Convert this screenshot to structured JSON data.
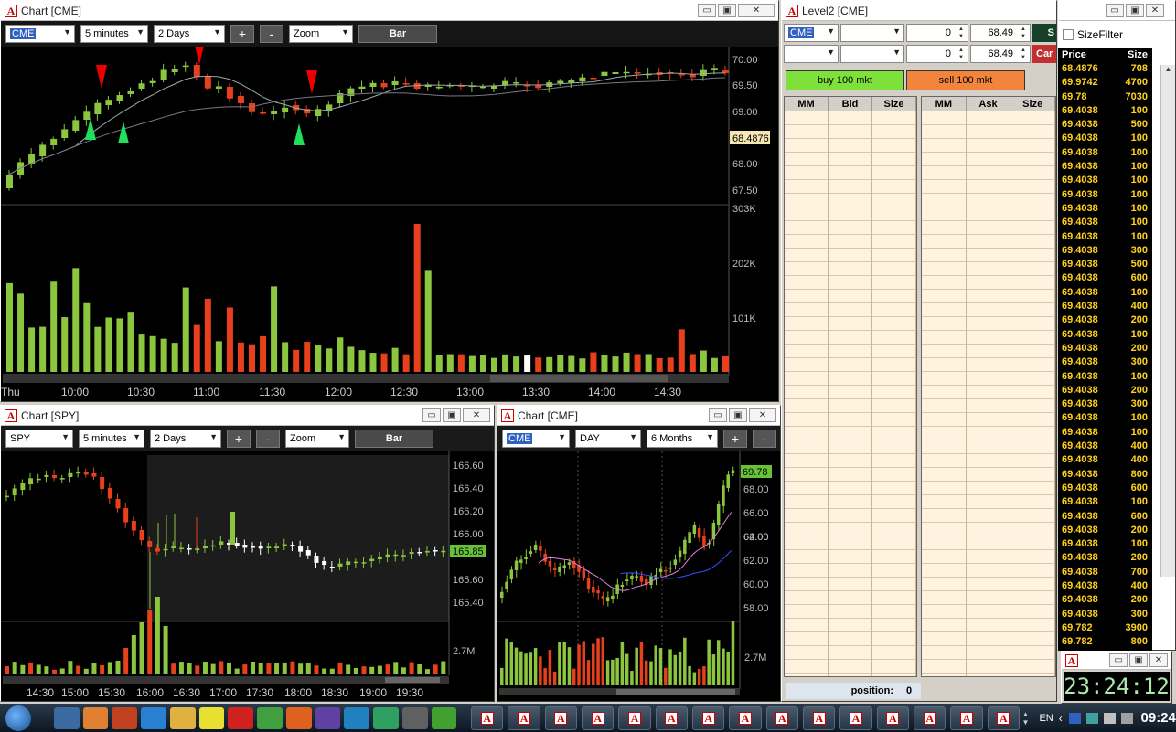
{
  "main_chart": {
    "title": "Chart [CME]",
    "symbol": "CME",
    "interval": "5 minutes",
    "range": "2 Days",
    "zoom": "Zoom",
    "mode": "Bar",
    "plus": "+",
    "minus": "-",
    "price_ticks": [
      "70.00",
      "69.50",
      "69.00",
      "68.00",
      "67.50"
    ],
    "last_price": "68.4876",
    "volume_ticks": [
      "303K",
      "202K",
      "101K"
    ],
    "time_labels": [
      "Thu",
      "10:00",
      "10:30",
      "11:00",
      "11:30",
      "12:00",
      "12:30",
      "13:00",
      "13:30",
      "14:00",
      "14:30"
    ]
  },
  "spy_chart": {
    "title": "Chart [SPY]",
    "symbol": "SPY",
    "interval": "5 minutes",
    "range": "2 Days",
    "zoom": "Zoom",
    "mode": "Bar",
    "plus": "+",
    "minus": "-",
    "price_ticks": [
      "166.60",
      "166.40",
      "166.20",
      "166.00",
      "165.60",
      "165.40"
    ],
    "last_price": "165.85",
    "volume_tick": "2.7M",
    "time_labels": [
      "14:30",
      "15:00",
      "15:30",
      "16:00",
      "16:30",
      "17:00",
      "17:30",
      "18:00",
      "18:30",
      "19:00",
      "19:30"
    ]
  },
  "day_chart": {
    "title": "Chart [CME]",
    "symbol": "CME",
    "interval": "DAY",
    "range": "6 Months",
    "plus": "+",
    "minus": "-",
    "price_ticks": [
      "68.00",
      "66.00",
      "64.00",
      "62.00",
      "62.00",
      "60.00",
      "58.00"
    ],
    "last_price": "69.78",
    "volume_tick": "2.7M"
  },
  "level2": {
    "title": "Level2 [CME]",
    "symbol": "CME",
    "qty1": "0",
    "price1": "68.49",
    "qty2": "0",
    "price2": "68.49",
    "side_btn1": "S",
    "side_btn2": "Car",
    "buy_label": "buy 100 mkt",
    "sell_label": "sell 100 mkt",
    "bid_headers": [
      "MM",
      "Bid",
      "Size"
    ],
    "ask_headers": [
      "MM",
      "Ask",
      "Size"
    ],
    "position_label": "position:",
    "position_value": "0"
  },
  "time_sales": {
    "filter_label": "SizeFilter",
    "headers": [
      "Price",
      "Size"
    ],
    "rows": [
      [
        "68.4876",
        "708"
      ],
      [
        "69.9742",
        "4700"
      ],
      [
        "69.78",
        "7030"
      ],
      [
        "69.4038",
        "100"
      ],
      [
        "69.4038",
        "500"
      ],
      [
        "69.4038",
        "100"
      ],
      [
        "69.4038",
        "100"
      ],
      [
        "69.4038",
        "100"
      ],
      [
        "69.4038",
        "100"
      ],
      [
        "69.4038",
        "100"
      ],
      [
        "69.4038",
        "100"
      ],
      [
        "69.4038",
        "100"
      ],
      [
        "69.4038",
        "100"
      ],
      [
        "69.4038",
        "300"
      ],
      [
        "69.4038",
        "500"
      ],
      [
        "69.4038",
        "600"
      ],
      [
        "69.4038",
        "100"
      ],
      [
        "69.4038",
        "400"
      ],
      [
        "69.4038",
        "200"
      ],
      [
        "69.4038",
        "100"
      ],
      [
        "69.4038",
        "200"
      ],
      [
        "69.4038",
        "300"
      ],
      [
        "69.4038",
        "100"
      ],
      [
        "69.4038",
        "200"
      ],
      [
        "69.4038",
        "300"
      ],
      [
        "69.4038",
        "100"
      ],
      [
        "69.4038",
        "100"
      ],
      [
        "69.4038",
        "400"
      ],
      [
        "69.4038",
        "400"
      ],
      [
        "69.4038",
        "800"
      ],
      [
        "69.4038",
        "600"
      ],
      [
        "69.4038",
        "100"
      ],
      [
        "69.4038",
        "600"
      ],
      [
        "69.4038",
        "200"
      ],
      [
        "69.4038",
        "100"
      ],
      [
        "69.4038",
        "200"
      ],
      [
        "69.4038",
        "700"
      ],
      [
        "69.4038",
        "400"
      ],
      [
        "69.4038",
        "200"
      ],
      [
        "69.4038",
        "300"
      ],
      [
        "69.782",
        "3900"
      ],
      [
        "69.782",
        "800"
      ]
    ]
  },
  "clock": {
    "time": "23:24:12"
  },
  "taskbar": {
    "lang": "EN",
    "time": "09:24"
  }
}
